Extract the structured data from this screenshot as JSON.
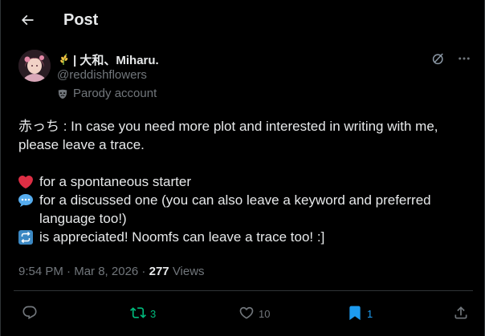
{
  "header": {
    "title": "Post"
  },
  "author": {
    "display_name": "| 大和、Miharu.",
    "handle": "@reddishflowers",
    "badge_label": "Parody account"
  },
  "post": {
    "line1": "赤っち : In case you need more plot and interested in writing with me, please leave a trace.",
    "line_heart": "for a spontaneous starter",
    "line_speech": "for a discussed one (you can also leave a keyword and preferred language too!)",
    "line_repeat": "is appreciated! Noomfs can leave a trace too! :]"
  },
  "meta": {
    "time": "9:54 PM",
    "date": "Mar 8, 2026",
    "separator": " · ",
    "views_count": "277",
    "views_label": "Views"
  },
  "actions": {
    "replies": "",
    "reposts": "3",
    "likes": "10",
    "bookmarks": "1"
  },
  "colors": {
    "background": "#000000",
    "text": "#e7e9ea",
    "muted": "#71767b",
    "repost_active": "#00ba7c",
    "bookmark_active": "#1d9bf0",
    "heart_emoji": "#dd2e44",
    "speech_emoji": "#55acee",
    "repeat_emoji": "#3b88c3"
  },
  "icons": {
    "back": "arrow-left-icon",
    "grok": "grok-icon",
    "more": "more-dots-icon",
    "parody": "mask-icon",
    "flower": "rice-flower-icon",
    "reply": "reply-icon",
    "repost": "repost-icon",
    "like": "heart-outline-icon",
    "bookmark": "bookmark-filled-icon",
    "share": "share-icon"
  }
}
